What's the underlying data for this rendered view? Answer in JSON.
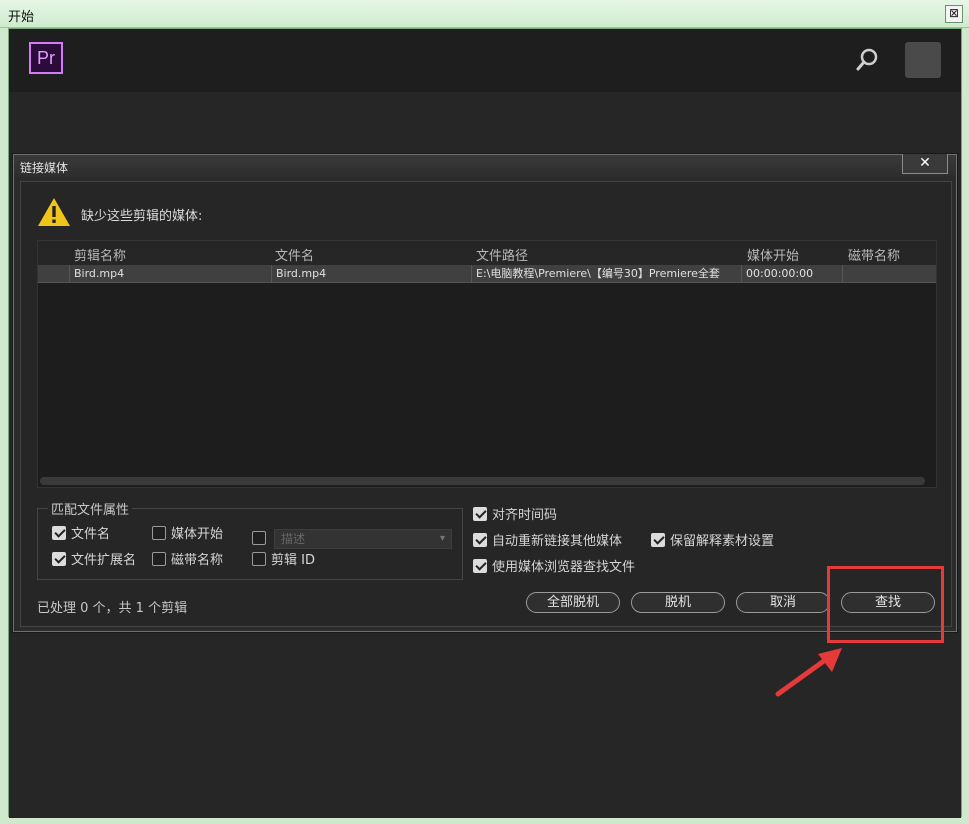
{
  "window": {
    "title": "开始",
    "close_symbol": "⊠"
  },
  "app": {
    "logo_text": "Pr",
    "search_icon": "search-icon"
  },
  "dialog": {
    "title": "链接媒体",
    "close_symbol": "✕",
    "warning": "缺少这些剪辑的媒体:",
    "table": {
      "headers": [
        "剪辑名称",
        "文件名",
        "文件路径",
        "媒体开始",
        "磁带名称"
      ],
      "rows": [
        [
          "Bird.mp4",
          "Bird.mp4",
          "E:\\电脑教程\\Premiere\\【编号30】Premiere全套",
          "00:00:00:00",
          ""
        ]
      ]
    },
    "match_group": {
      "title": "匹配文件属性",
      "options": [
        {
          "label": "文件名",
          "checked": true
        },
        {
          "label": "媒体开始",
          "checked": false
        },
        {
          "label": "",
          "checked": false
        },
        {
          "label": "文件扩展名",
          "checked": true
        },
        {
          "label": "磁带名称",
          "checked": false
        },
        {
          "label": "剪辑 ID",
          "checked": false
        }
      ],
      "description_placeholder": "描述"
    },
    "options": [
      {
        "label": "对齐时间码",
        "checked": true
      },
      {
        "label": "自动重新链接其他媒体",
        "checked": true
      },
      {
        "label": "保留解释素材设置",
        "checked": true
      },
      {
        "label": "使用媒体浏览器查找文件",
        "checked": true
      }
    ],
    "status": "已处理 0 个，共 1 个剪辑",
    "buttons": {
      "offline_all": "全部脱机",
      "offline": "脱机",
      "cancel": "取消",
      "find": "查找"
    }
  },
  "colors": {
    "accent": "#e63a3a",
    "pr_logo": "#d27bf5"
  }
}
